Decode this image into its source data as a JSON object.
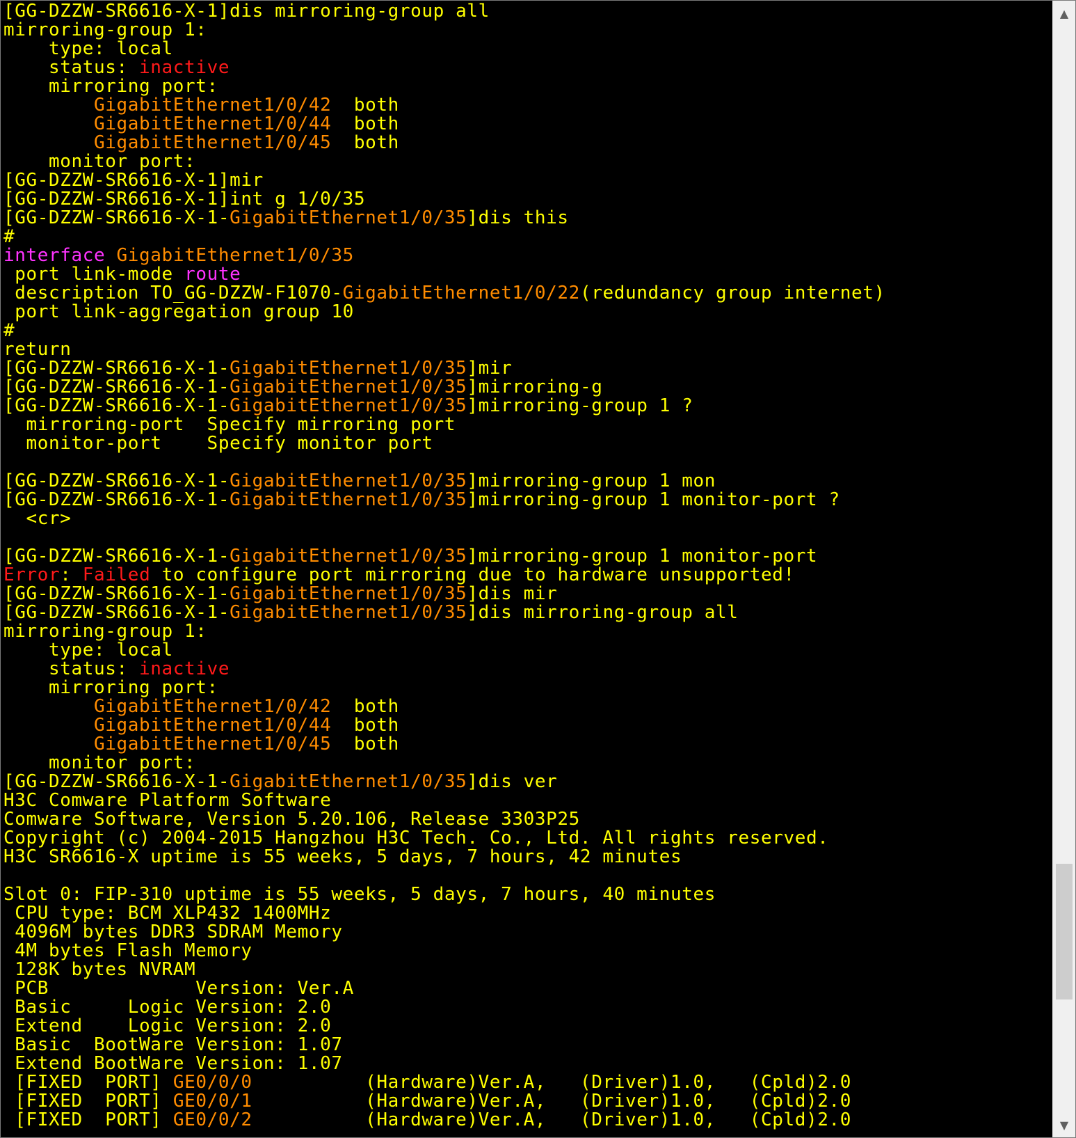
{
  "terminal": {
    "lines": [
      [
        [
          "[GG-DZZW-SR6616-X-1]dis mirroring-group all",
          "y"
        ]
      ],
      [
        [
          "mirroring-group 1:",
          "y"
        ]
      ],
      [
        [
          "    type: local",
          "y"
        ]
      ],
      [
        [
          "    status: ",
          "y"
        ],
        [
          "inactive",
          "r"
        ]
      ],
      [
        [
          "    mirroring port:",
          "y"
        ]
      ],
      [
        [
          "        ",
          "y"
        ],
        [
          "GigabitEthernet1/0/42",
          "o"
        ],
        [
          "  both",
          "y"
        ]
      ],
      [
        [
          "        ",
          "y"
        ],
        [
          "GigabitEthernet1/0/44",
          "o"
        ],
        [
          "  both",
          "y"
        ]
      ],
      [
        [
          "        ",
          "y"
        ],
        [
          "GigabitEthernet1/0/45",
          "o"
        ],
        [
          "  both",
          "y"
        ]
      ],
      [
        [
          "    monitor port:",
          "y"
        ]
      ],
      [
        [
          "[GG-DZZW-SR6616-X-1]mir",
          "y"
        ]
      ],
      [
        [
          "[GG-DZZW-SR6616-X-1]int g 1/0/35",
          "y"
        ]
      ],
      [
        [
          "[GG-DZZW-SR6616-X-1-",
          "y"
        ],
        [
          "GigabitEthernet1/0/35",
          "o"
        ],
        [
          "]dis this",
          "y"
        ]
      ],
      [
        [
          "#",
          "y"
        ]
      ],
      [
        [
          "interface ",
          "m"
        ],
        [
          "GigabitEthernet1/0/35",
          "o"
        ]
      ],
      [
        [
          " port link-mode ",
          "y"
        ],
        [
          "route",
          "m"
        ]
      ],
      [
        [
          " description TO_GG-DZZW-F1070-",
          "y"
        ],
        [
          "GigabitEthernet1/0/22",
          "o"
        ],
        [
          "(redundancy group internet)",
          "y"
        ]
      ],
      [
        [
          " port link-aggregation group 10",
          "y"
        ]
      ],
      [
        [
          "#",
          "y"
        ]
      ],
      [
        [
          "return",
          "y"
        ]
      ],
      [
        [
          "[GG-DZZW-SR6616-X-1-",
          "y"
        ],
        [
          "GigabitEthernet1/0/35",
          "o"
        ],
        [
          "]mir",
          "y"
        ]
      ],
      [
        [
          "[GG-DZZW-SR6616-X-1-",
          "y"
        ],
        [
          "GigabitEthernet1/0/35",
          "o"
        ],
        [
          "]mirroring-g",
          "y"
        ]
      ],
      [
        [
          "[GG-DZZW-SR6616-X-1-",
          "y"
        ],
        [
          "GigabitEthernet1/0/35",
          "o"
        ],
        [
          "]mirroring-group 1 ?",
          "y"
        ]
      ],
      [
        [
          "  mirroring-port  Specify mirroring port",
          "y"
        ]
      ],
      [
        [
          "  monitor-port    Specify monitor port",
          "y"
        ]
      ],
      [],
      [
        [
          "[GG-DZZW-SR6616-X-1-",
          "y"
        ],
        [
          "GigabitEthernet1/0/35",
          "o"
        ],
        [
          "]mirroring-group 1 mon",
          "y"
        ]
      ],
      [
        [
          "[GG-DZZW-SR6616-X-1-",
          "y"
        ],
        [
          "GigabitEthernet1/0/35",
          "o"
        ],
        [
          "]mirroring-group 1 monitor-port ?",
          "y"
        ]
      ],
      [
        [
          "  <cr>",
          "y"
        ]
      ],
      [],
      [
        [
          "[GG-DZZW-SR6616-X-1-",
          "y"
        ],
        [
          "GigabitEthernet1/0/35",
          "o"
        ],
        [
          "]mirroring-group 1 monitor-port",
          "y"
        ]
      ],
      [
        [
          "Error",
          "r"
        ],
        [
          ": ",
          "y"
        ],
        [
          "Failed",
          "r"
        ],
        [
          " to configure port mirroring due to hardware unsupported!",
          "y"
        ]
      ],
      [
        [
          "[GG-DZZW-SR6616-X-1-",
          "y"
        ],
        [
          "GigabitEthernet1/0/35",
          "o"
        ],
        [
          "]dis mir",
          "y"
        ]
      ],
      [
        [
          "[GG-DZZW-SR6616-X-1-",
          "y"
        ],
        [
          "GigabitEthernet1/0/35",
          "o"
        ],
        [
          "]dis mirroring-group all",
          "y"
        ]
      ],
      [
        [
          "mirroring-group 1:",
          "y"
        ]
      ],
      [
        [
          "    type: local",
          "y"
        ]
      ],
      [
        [
          "    status: ",
          "y"
        ],
        [
          "inactive",
          "r"
        ]
      ],
      [
        [
          "    mirroring port:",
          "y"
        ]
      ],
      [
        [
          "        ",
          "y"
        ],
        [
          "GigabitEthernet1/0/42",
          "o"
        ],
        [
          "  both",
          "y"
        ]
      ],
      [
        [
          "        ",
          "y"
        ],
        [
          "GigabitEthernet1/0/44",
          "o"
        ],
        [
          "  both",
          "y"
        ]
      ],
      [
        [
          "        ",
          "y"
        ],
        [
          "GigabitEthernet1/0/45",
          "o"
        ],
        [
          "  both",
          "y"
        ]
      ],
      [
        [
          "    monitor port:",
          "y"
        ]
      ],
      [
        [
          "[GG-DZZW-SR6616-X-1-",
          "y"
        ],
        [
          "GigabitEthernet1/0/35",
          "o"
        ],
        [
          "]dis ver",
          "y"
        ]
      ],
      [
        [
          "H3C Comware Platform Software",
          "y"
        ]
      ],
      [
        [
          "Comware Software, Version 5.20.106, Release 3303P25",
          "y"
        ]
      ],
      [
        [
          "Copyright (c) 2004-2015 Hangzhou H3C Tech. Co., Ltd. All rights reserved.",
          "y"
        ]
      ],
      [
        [
          "H3C SR6616-X uptime is 55 weeks, 5 days, 7 hours, 42 minutes",
          "y"
        ]
      ],
      [],
      [
        [
          "Slot 0: FIP-310 uptime is 55 weeks, 5 days, 7 hours, 40 minutes",
          "y"
        ]
      ],
      [
        [
          " CPU type: BCM XLP432 1400MHz",
          "y"
        ]
      ],
      [
        [
          " 4096M bytes DDR3 SDRAM Memory",
          "y"
        ]
      ],
      [
        [
          " 4M bytes Flash Memory",
          "y"
        ]
      ],
      [
        [
          " 128K bytes NVRAM",
          "y"
        ]
      ],
      [
        [
          " PCB             Version: Ver.A",
          "y"
        ]
      ],
      [
        [
          " Basic     Logic Version: 2.0",
          "y"
        ]
      ],
      [
        [
          " Extend    Logic Version: 2.0",
          "y"
        ]
      ],
      [
        [
          " Basic  BootWare Version: 1.07",
          "y"
        ]
      ],
      [
        [
          " Extend BootWare Version: 1.07",
          "y"
        ]
      ],
      [
        [
          " [FIXED  PORT] ",
          "y"
        ],
        [
          "GE0/0/0",
          "o"
        ],
        [
          "          (Hardware)Ver.A,   (Driver)1.0,   (Cpld)2.0",
          "y"
        ]
      ],
      [
        [
          " [FIXED  PORT] ",
          "y"
        ],
        [
          "GE0/0/1",
          "o"
        ],
        [
          "          (Hardware)Ver.A,   (Driver)1.0,   (Cpld)2.0",
          "y"
        ]
      ],
      [
        [
          " [FIXED  PORT] ",
          "y"
        ],
        [
          "GE0/0/2",
          "o"
        ],
        [
          "          (Hardware)Ver.A,   (Driver)1.0,   (Cpld)2.0",
          "y"
        ]
      ]
    ]
  },
  "scrollbar": {
    "up_icon": "▲",
    "down_icon": "▼",
    "position_fraction": 0.88
  }
}
